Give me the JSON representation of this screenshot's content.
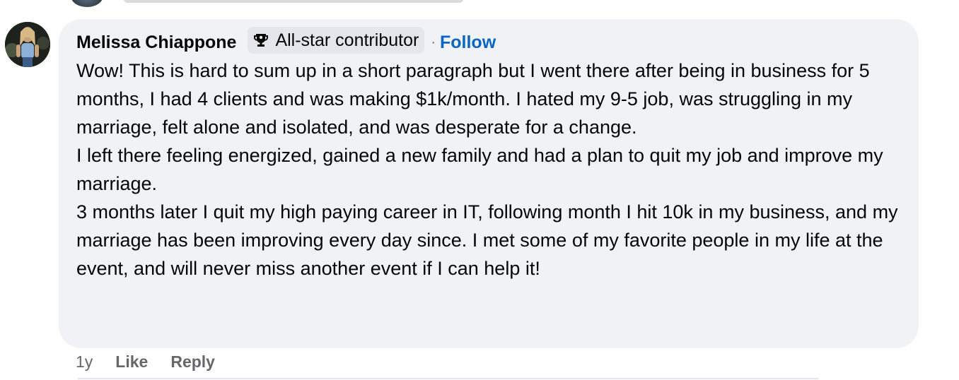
{
  "comment": {
    "author": "Melissa Chiappone",
    "badge_label": "All-star contributor",
    "separator": "·",
    "follow_label": "Follow",
    "paragraphs": [
      "Wow! This is hard to sum up in a short paragraph but I went there after being in business for 5 months, I had 4 clients and was making $1k/month. I hated my 9-5 job, was struggling in my marriage, felt alone and isolated, and was desperate for a change.",
      "I left there feeling energized, gained a new family and had a plan to quit my job and improve my marriage.",
      "3 months later I quit my high paying career in IT, following month I hit 10k in my business, and my marriage has been improving every day since. I met some of my favorite people in my life at the event, and will never miss another event if I can help it!"
    ],
    "time_ago": "1y",
    "like_label": "Like",
    "reply_label": "Reply"
  },
  "icons": {
    "badge_icon": "trophy-icon"
  },
  "colors": {
    "bubble_bg": "#f0f2f5",
    "badge_bg": "#e4e6eb",
    "follow": "#0a66c2",
    "secondary_text": "#65676b"
  }
}
